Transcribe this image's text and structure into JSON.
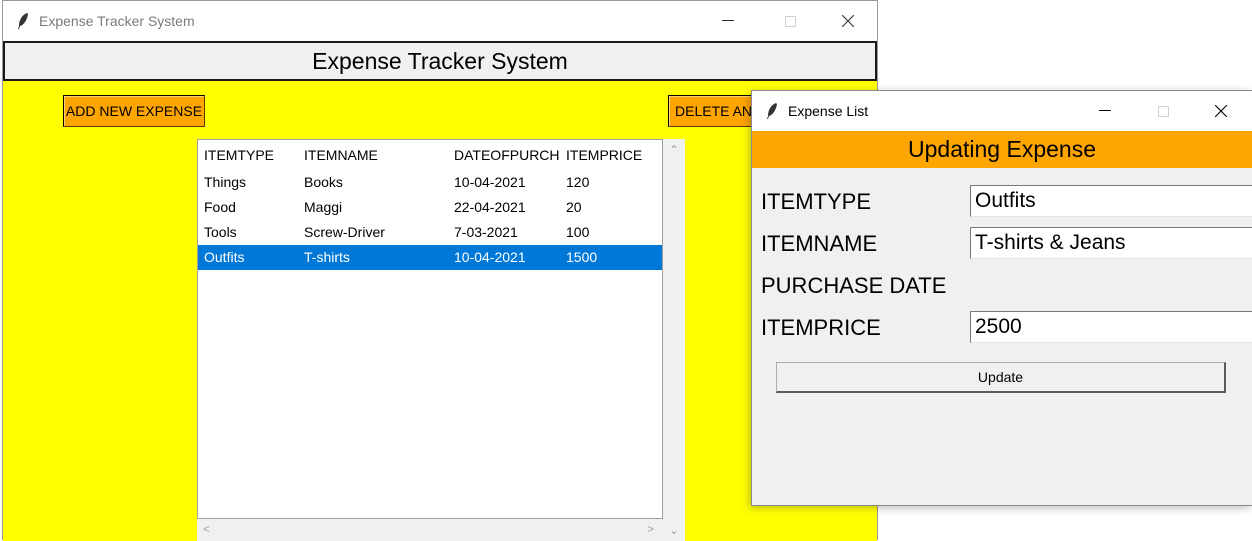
{
  "main_window": {
    "title": "Expense Tracker System",
    "header": "Expense Tracker System",
    "add_button": "ADD NEW EXPENSE",
    "delete_button": "DELETE AN ITEM",
    "table": {
      "columns": [
        "ITEMTYPE",
        "ITEMNAME",
        "DATEOFPURCH",
        "ITEMPRICE"
      ],
      "rows": [
        [
          "Things",
          "Books",
          "10-04-2021",
          "120"
        ],
        [
          "Food",
          "Maggi",
          "22-04-2021",
          "20"
        ],
        [
          "Tools",
          "Screw-Driver",
          "7-03-2021",
          "100"
        ],
        [
          "Outfits",
          "T-shirts",
          "10-04-2021",
          "1500"
        ]
      ],
      "selected_row": 3
    }
  },
  "popup_window": {
    "title": "Expense List",
    "header": "Updating Expense",
    "fields": {
      "itemtype_label": "ITEMTYPE",
      "itemtype_value": "Outfits",
      "itemname_label": "ITEMNAME",
      "itemname_value": "T-shirts & Jeans",
      "purchase_date_label": "PURCHASE DATE",
      "itemprice_label": "ITEMPRICE",
      "itemprice_value": "2500"
    },
    "update_button": "Update"
  },
  "colors": {
    "body_background": "#ffff00",
    "button_orange": "#ffa500",
    "selection_blue": "#0078d7",
    "popup_header": "#ffa500"
  },
  "icons": {
    "app_icon": "feather-icon",
    "minimize": "minimize-icon",
    "maximize": "maximize-icon",
    "close": "close-icon"
  }
}
